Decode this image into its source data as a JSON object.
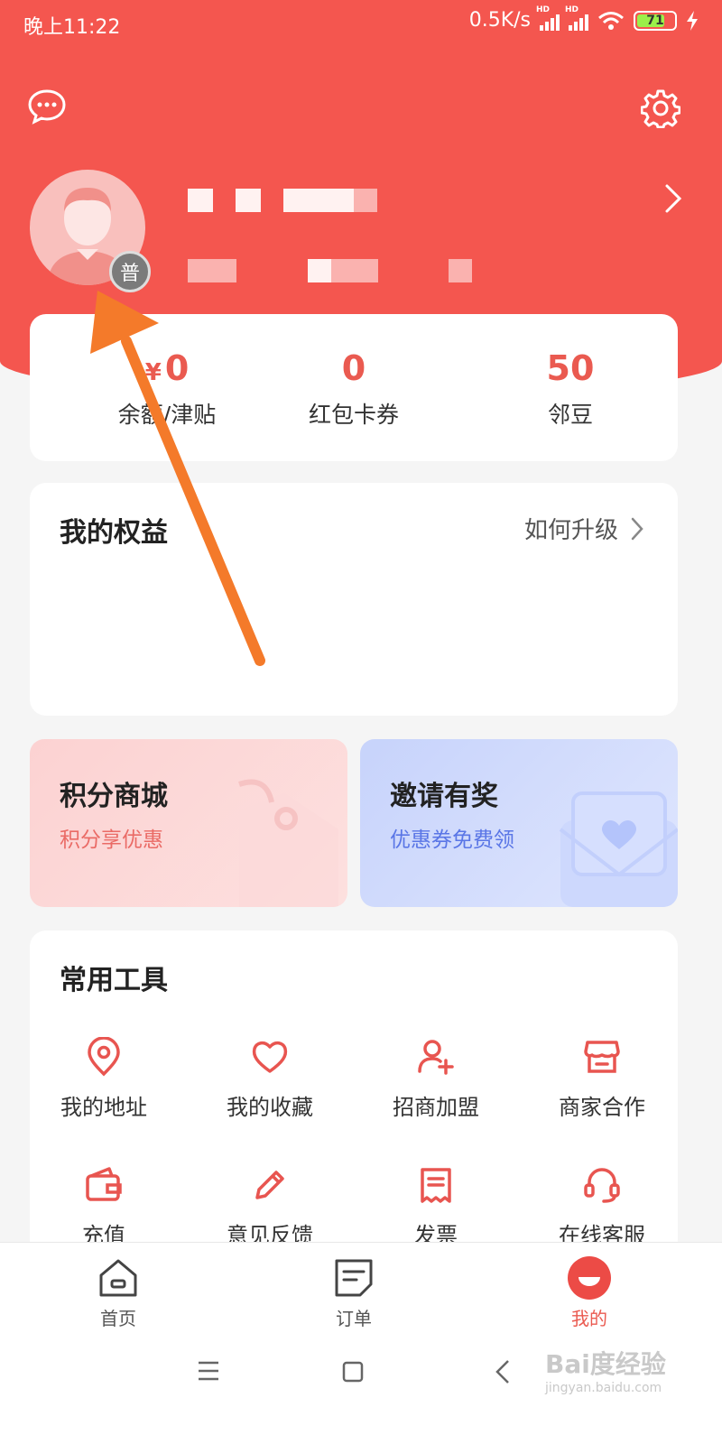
{
  "status_bar": {
    "time": "晚上11:22",
    "speed": "0.5K/s",
    "hd1": "HD",
    "hd2": "HD",
    "battery": "71"
  },
  "profile": {
    "badge": "普"
  },
  "stats": [
    {
      "currency": "¥",
      "value": "0",
      "label": "余额/津贴"
    },
    {
      "value": "0",
      "label": "红包卡券"
    },
    {
      "value": "50",
      "label": "邻豆"
    }
  ],
  "benefits": {
    "title": "我的权益",
    "upgrade_link": "如何升级"
  },
  "promos": {
    "points": {
      "title": "积分商城",
      "subtitle": "积分享优惠"
    },
    "invite": {
      "title": "邀请有奖",
      "subtitle": "优惠券免费领"
    }
  },
  "tools": {
    "title": "常用工具",
    "items": [
      {
        "label": "我的地址",
        "icon": "location-pin-icon"
      },
      {
        "label": "我的收藏",
        "icon": "heart-icon"
      },
      {
        "label": "招商加盟",
        "icon": "add-user-icon"
      },
      {
        "label": "商家合作",
        "icon": "store-icon"
      },
      {
        "label": "充值",
        "icon": "wallet-icon"
      },
      {
        "label": "意见反馈",
        "icon": "pencil-icon"
      },
      {
        "label": "发票",
        "icon": "receipt-icon"
      },
      {
        "label": "在线客服",
        "icon": "headset-icon"
      }
    ]
  },
  "bottom_nav": {
    "home": "首页",
    "orders": "订单",
    "mine": "我的"
  },
  "watermark": {
    "brand": "Bai度经验",
    "domain": "jingyan.baidu.com"
  },
  "colors": {
    "primary": "#f4564f",
    "accent_text": "#ea5a50",
    "arrow": "#f47a2a"
  }
}
